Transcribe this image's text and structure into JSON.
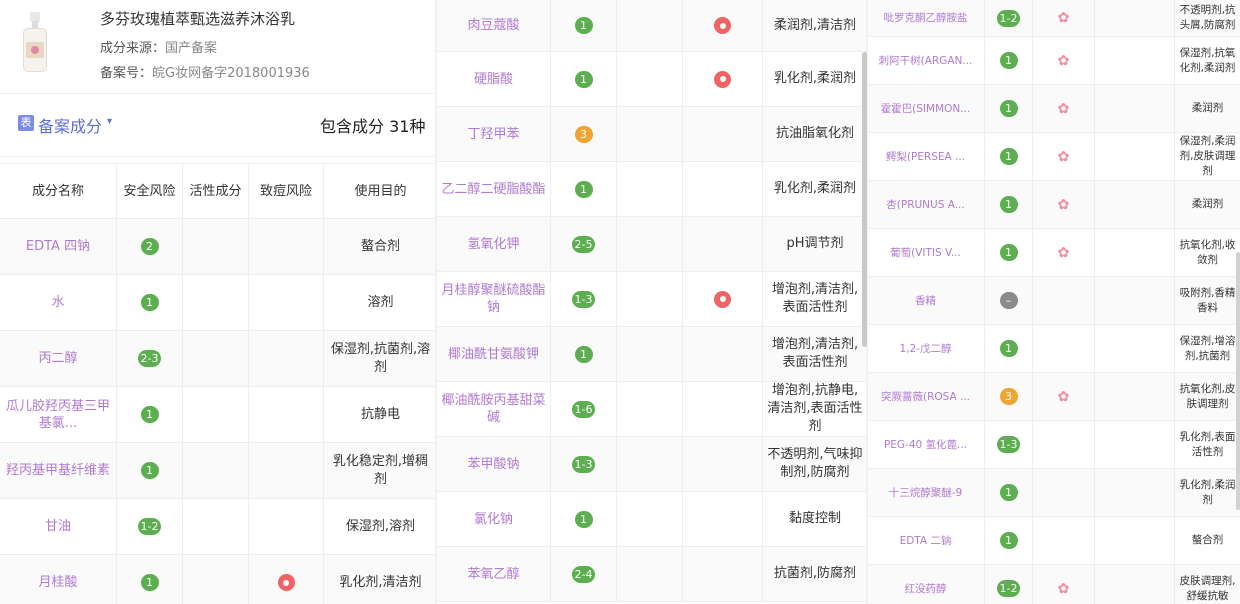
{
  "product": {
    "name": "多芬玫瑰植萃甄选滋养沐浴乳",
    "source_label": "成分来源：",
    "source_value": "国产备案",
    "reg_label": "备案号：",
    "reg_value": "皖G妆网备字2018001936"
  },
  "section": {
    "icon_text": "表",
    "title": "备案成分",
    "caret": "▾",
    "count_text": "包含成分 31种"
  },
  "columns": [
    "成分名称",
    "安全风险",
    "活性成分",
    "致痘风险",
    "使用目的"
  ],
  "table1": [
    {
      "name": "EDTA 四钠",
      "risk": "2",
      "risk_color": "green",
      "active": false,
      "acne": false,
      "purpose": "螯合剂"
    },
    {
      "name": "水",
      "risk": "1",
      "risk_color": "green",
      "active": false,
      "acne": false,
      "purpose": "溶剂"
    },
    {
      "name": "丙二醇",
      "risk": "2-3",
      "risk_color": "green",
      "active": false,
      "acne": false,
      "purpose": "保湿剂,抗菌剂,溶剂"
    },
    {
      "name": "瓜儿胶羟丙基三甲基氯...",
      "risk": "1",
      "risk_color": "green",
      "active": false,
      "acne": false,
      "purpose": "抗静电"
    },
    {
      "name": "羟丙基甲基纤维素",
      "risk": "1",
      "risk_color": "green",
      "active": false,
      "acne": false,
      "purpose": "乳化稳定剂,增稠剂"
    },
    {
      "name": "甘油",
      "risk": "1-2",
      "risk_color": "green",
      "active": false,
      "acne": false,
      "purpose": "保湿剂,溶剂"
    },
    {
      "name": "月桂酸",
      "risk": "1",
      "risk_color": "green",
      "active": false,
      "acne": true,
      "purpose": "乳化剂,清洁剂"
    }
  ],
  "table2": [
    {
      "name": "肉豆蔻酸",
      "risk": "1",
      "risk_color": "green",
      "active": false,
      "acne": true,
      "purpose": "柔润剂,清洁剂"
    },
    {
      "name": "硬脂酸",
      "risk": "1",
      "risk_color": "green",
      "active": false,
      "acne": true,
      "purpose": "乳化剂,柔润剂"
    },
    {
      "name": "丁羟甲苯",
      "risk": "3",
      "risk_color": "orange",
      "active": false,
      "acne": false,
      "purpose": "抗油脂氧化剂"
    },
    {
      "name": "乙二醇二硬脂酸酯",
      "risk": "1",
      "risk_color": "green",
      "active": false,
      "acne": false,
      "purpose": "乳化剂,柔润剂"
    },
    {
      "name": "氢氧化钾",
      "risk": "2-5",
      "risk_color": "green",
      "active": false,
      "acne": false,
      "purpose": "pH调节剂"
    },
    {
      "name": "月桂醇聚醚硫酸酯钠",
      "risk": "1-3",
      "risk_color": "green",
      "active": false,
      "acne": true,
      "purpose": "增泡剂,清洁剂,表面活性剂"
    },
    {
      "name": "椰油酰甘氨酸钾",
      "risk": "1",
      "risk_color": "green",
      "active": false,
      "acne": false,
      "purpose": "增泡剂,清洁剂,表面活性剂"
    },
    {
      "name": "椰油酰胺丙基甜菜碱",
      "risk": "1-6",
      "risk_color": "green",
      "active": false,
      "acne": false,
      "purpose": "增泡剂,抗静电,清洁剂,表面活性剂"
    },
    {
      "name": "苯甲酸钠",
      "risk": "1-3",
      "risk_color": "green",
      "active": false,
      "acne": false,
      "purpose": "不透明剂,气味抑制剂,防腐剂"
    },
    {
      "name": "氯化钠",
      "risk": "1",
      "risk_color": "green",
      "active": false,
      "acne": false,
      "purpose": "黏度控制"
    },
    {
      "name": "苯氧乙醇",
      "risk": "2-4",
      "risk_color": "green",
      "active": false,
      "acne": false,
      "purpose": "抗菌剂,防腐剂"
    }
  ],
  "table3": [
    {
      "name": "吡罗克酮乙醇胺盐",
      "risk": "1-2",
      "risk_color": "green",
      "active": true,
      "acne": false,
      "purpose": "不透明剂,抗头屑,防腐剂"
    },
    {
      "name": "刺阿干树(ARGAN...",
      "risk": "1",
      "risk_color": "green",
      "active": true,
      "acne": false,
      "purpose": "保湿剂,抗氧化剂,柔润剂"
    },
    {
      "name": "霍霍巴(SIMMON...",
      "risk": "1",
      "risk_color": "green",
      "active": true,
      "acne": false,
      "purpose": "柔润剂"
    },
    {
      "name": "鳄梨(PERSEA ...",
      "risk": "1",
      "risk_color": "green",
      "active": true,
      "acne": false,
      "purpose": "保湿剂,柔润剂,皮肤调理剂"
    },
    {
      "name": "杏(PRUNUS A...",
      "risk": "1",
      "risk_color": "green",
      "active": true,
      "acne": false,
      "purpose": "柔润剂"
    },
    {
      "name": "葡萄(VITIS V...",
      "risk": "1",
      "risk_color": "green",
      "active": true,
      "acne": false,
      "purpose": "抗氧化剂,收敛剂"
    },
    {
      "name": "香精",
      "risk": "–",
      "risk_color": "gray",
      "active": false,
      "acne": false,
      "purpose": "吸附剂,香精香料"
    },
    {
      "name": "1,2-戊二醇",
      "risk": "1",
      "risk_color": "green",
      "active": false,
      "acne": false,
      "purpose": "保湿剂,增溶剂,抗菌剂"
    },
    {
      "name": "突厥蔷薇(ROSA ...",
      "risk": "3",
      "risk_color": "orange",
      "active": true,
      "acne": false,
      "purpose": "抗氧化剂,皮肤调理剂"
    },
    {
      "name": "PEG-40 氢化蓖...",
      "risk": "1-3",
      "risk_color": "green",
      "active": false,
      "acne": false,
      "purpose": "乳化剂,表面活性剂"
    },
    {
      "name": "十三烷醇聚醚-9",
      "risk": "1",
      "risk_color": "green",
      "active": false,
      "acne": false,
      "purpose": "乳化剂,柔润剂"
    },
    {
      "name": "EDTA 二钠",
      "risk": "1",
      "risk_color": "green",
      "active": false,
      "acne": false,
      "purpose": "螯合剂"
    },
    {
      "name": "红没药醇",
      "risk": "1-2",
      "risk_color": "green",
      "active": true,
      "acne": false,
      "purpose": "皮肤调理剂,舒缓抗敏"
    }
  ],
  "icons": {
    "active": "flower-icon",
    "acne": "acne-dot-icon",
    "section": "table-icon",
    "product": "product-image"
  },
  "colors": {
    "green": "#5cae51",
    "orange": "#f0a431",
    "gray": "#8a8a8a",
    "red": "#ef6363",
    "name_purple": "#b07ad2",
    "accent_blue": "#5d6ed9"
  }
}
